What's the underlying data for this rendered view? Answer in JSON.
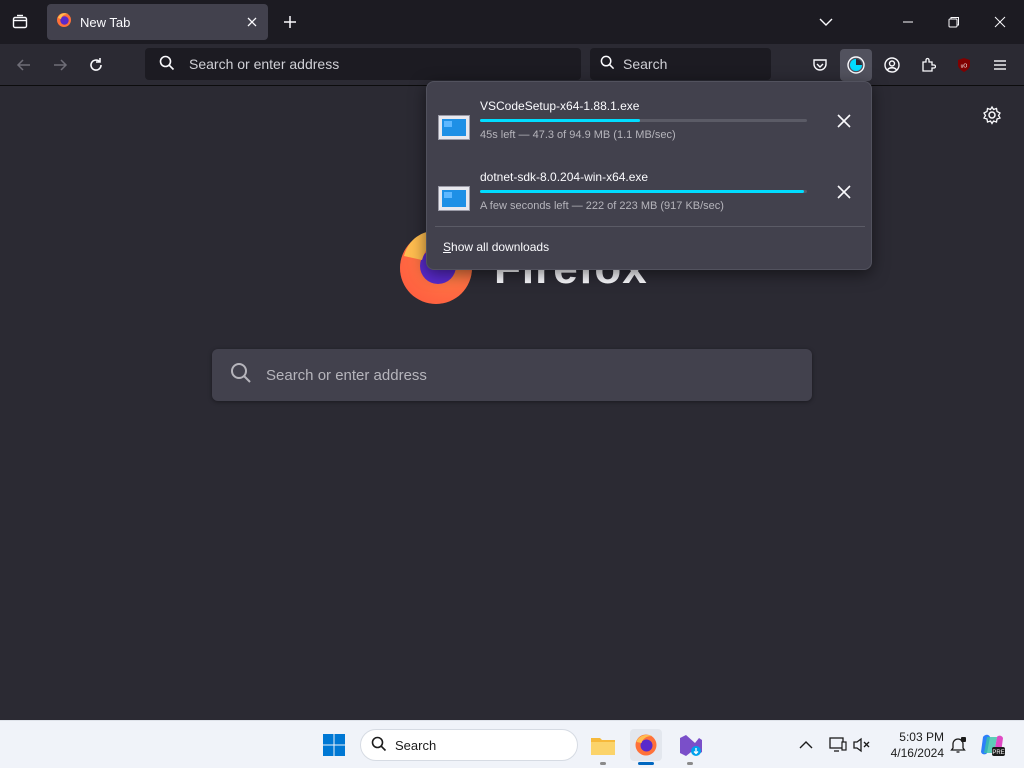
{
  "tabstrip": {
    "tab_title": "New Tab"
  },
  "navbar": {
    "url_placeholder": "Search or enter address",
    "search_placeholder": "Search"
  },
  "content": {
    "wordmark": "Firefox",
    "search_placeholder": "Search or enter address"
  },
  "downloads": {
    "items": [
      {
        "name": "VSCodeSetup-x64-1.88.1.exe",
        "status": "45s left — 47.3 of 94.9 MB (1.1 MB/sec)",
        "progress": 0.49
      },
      {
        "name": "dotnet-sdk-8.0.204-win-x64.exe",
        "status": "A few seconds left — 222 of 223 MB (917 KB/sec)",
        "progress": 0.99
      }
    ],
    "show_all_first": "S",
    "show_all_rest": "how all downloads"
  },
  "taskbar": {
    "search_label": "Search",
    "time": "5:03 PM",
    "date": "4/16/2024"
  },
  "colors": {
    "accent": "#00ddff",
    "background": "#2b2a33",
    "toolbar": "#2b2a33",
    "panel": "#42414d"
  },
  "icons": {
    "tab_list": "tab-list-icon",
    "firefox": "firefox-icon",
    "close": "close-icon",
    "new_tab": "plus-icon",
    "back": "back-arrow-icon",
    "forward": "forward-arrow-icon",
    "reload": "reload-icon",
    "pocket": "pocket-icon",
    "downloads": "downloads-icon",
    "account": "account-icon",
    "extensions": "extensions-icon",
    "ublock": "ublock-icon",
    "menu": "hamburger-menu-icon",
    "settings": "gear-icon"
  }
}
